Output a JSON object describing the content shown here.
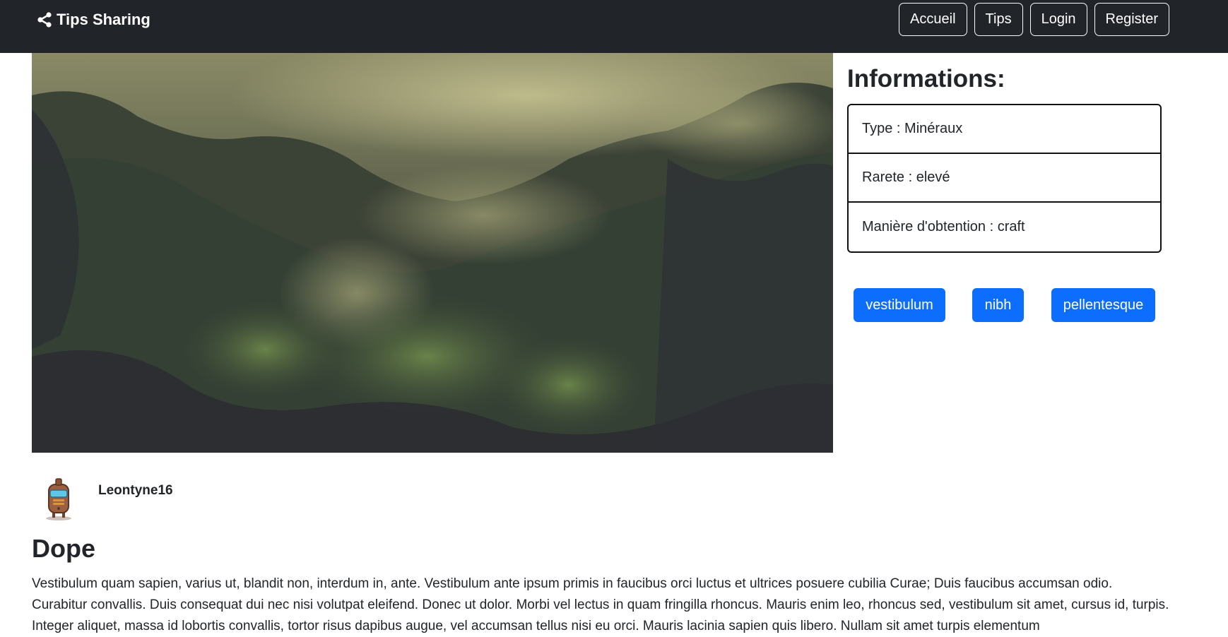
{
  "navbar": {
    "brand": "Tips Sharing",
    "brand_icon": "share-icon",
    "links": [
      "Accueil",
      "Tips",
      "Login",
      "Register"
    ]
  },
  "hero": {
    "image": "misty-forest-landscape"
  },
  "info": {
    "title": "Informations:",
    "items": [
      "Type : Minéraux",
      "Rarete : elevé",
      "Manière d'obtention : craft"
    ]
  },
  "tags": [
    "vestibulum",
    "nibh",
    "pellentesque"
  ],
  "author": {
    "name": "Leontyne16",
    "avatar": "robot-avatar"
  },
  "post": {
    "title": "Dope",
    "body": "Vestibulum quam sapien, varius ut, blandit non, interdum in, ante. Vestibulum ante ipsum primis in faucibus orci luctus et ultrices posuere cubilia Curae; Duis faucibus accumsan odio. Curabitur convallis. Duis consequat dui nec nisi volutpat eleifend. Donec ut dolor. Morbi vel lectus in quam fringilla rhoncus. Mauris enim leo, rhoncus sed, vestibulum sit amet, cursus id, turpis. Integer aliquet, massa id lobortis convallis, tortor risus dapibus augue, vel accumsan tellus nisi eu orci. Mauris lacinia sapien quis libero. Nullam sit amet turpis elementum"
  },
  "colors": {
    "navbar_bg": "#212529",
    "primary": "#0d6efd",
    "text": "#212529"
  }
}
